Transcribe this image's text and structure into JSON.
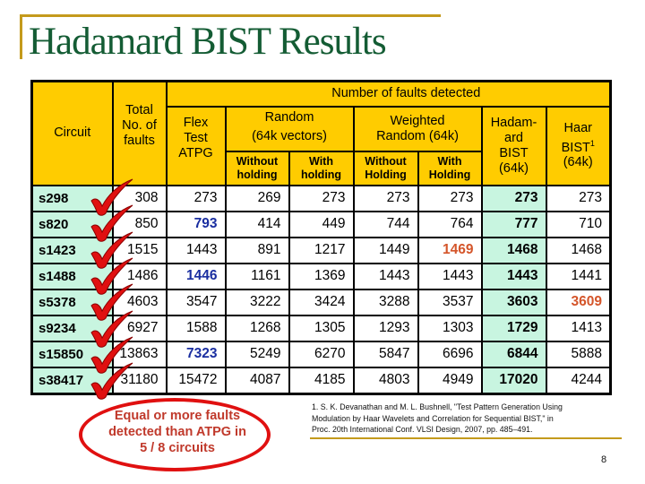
{
  "slide": {
    "title": "Hadamard BIST Results",
    "page_number": "8",
    "accent_color": "#c49a1c",
    "title_color": "#145c34"
  },
  "table": {
    "headers": {
      "circuit": "Circuit",
      "total": [
        "Total",
        "No. of",
        "faults"
      ],
      "group": "Number of faults detected",
      "flex": [
        "Flex",
        "Test",
        "ATPG"
      ],
      "random": [
        "Random",
        "(64k vectors)"
      ],
      "weighted": [
        "Weighted",
        "Random (64k)"
      ],
      "random_without": [
        "Without",
        "holding"
      ],
      "random_with": [
        "With",
        "holding"
      ],
      "weighted_without": [
        "Without",
        "Holding"
      ],
      "weighted_with": [
        "With",
        "Holding"
      ],
      "hadamard": [
        "Hadam-",
        "ard",
        "BIST",
        "(64k)"
      ],
      "haar": [
        "Haar",
        "BIST",
        "1",
        "(64k)"
      ]
    },
    "rows": [
      {
        "circuit": "s298",
        "total": "308",
        "flex": "273",
        "rand_wo": "269",
        "rand_w": "273",
        "wr_wo": "273",
        "wr_w": "273",
        "hadamard": "273",
        "haar": "273",
        "checked": true
      },
      {
        "circuit": "s820",
        "total": "850",
        "flex": "793",
        "rand_wo": "414",
        "rand_w": "449",
        "wr_wo": "744",
        "wr_w": "764",
        "hadamard": "777",
        "haar": "710",
        "checked": true
      },
      {
        "circuit": "s1423",
        "total": "1515",
        "flex": "1443",
        "rand_wo": "891",
        "rand_w": "1217",
        "wr_wo": "1449",
        "wr_w": "1469",
        "hadamard": "1468",
        "haar": "1468",
        "checked": true
      },
      {
        "circuit": "s1488",
        "total": "1486",
        "flex": "1446",
        "rand_wo": "1161",
        "rand_w": "1369",
        "wr_wo": "1443",
        "wr_w": "1443",
        "hadamard": "1443",
        "haar": "1441",
        "checked": true
      },
      {
        "circuit": "s5378",
        "total": "4603",
        "flex": "3547",
        "rand_wo": "3222",
        "rand_w": "3424",
        "wr_wo": "3288",
        "wr_w": "3537",
        "hadamard": "3603",
        "haar": "3609",
        "checked": true
      },
      {
        "circuit": "s9234",
        "total": "6927",
        "flex": "1588",
        "rand_wo": "1268",
        "rand_w": "1305",
        "wr_wo": "1293",
        "wr_w": "1303",
        "hadamard": "1729",
        "haar": "1413",
        "checked": true
      },
      {
        "circuit": "s15850",
        "total": "13863",
        "flex": "7323",
        "rand_wo": "5249",
        "rand_w": "6270",
        "wr_wo": "5847",
        "wr_w": "6696",
        "hadamard": "6844",
        "haar": "5888",
        "checked": true
      },
      {
        "circuit": "s38417",
        "total": "31180",
        "flex": "15472",
        "rand_wo": "4087",
        "rand_w": "4185",
        "wr_wo": "4803",
        "wr_w": "4949",
        "hadamard": "17020",
        "haar": "4244",
        "checked": true
      }
    ],
    "highlights": {
      "blue": [
        "1.flex",
        "3.flex",
        "6.flex"
      ],
      "orange": [
        "2.wr_w",
        "4.haar"
      ]
    },
    "colors": {
      "header_bg": "#ffcc00",
      "circuit_bg": "#c8f5e0",
      "hadamard_bg": "#c8f5e0",
      "blue_text": "#1a2ea0",
      "orange_text": "#d4552a",
      "check": "#e01010"
    }
  },
  "callout": {
    "lines": [
      "Equal or more faults",
      "detected than ATPG in",
      "5 / 8 circuits"
    ],
    "color": "#c0392b"
  },
  "reference": {
    "lines": [
      "1. S. K. Devanathan and M. L. Bushnell, \"Test Pattern Generation Using",
      "Modulation by Haar Wavelets and Correlation for Sequential BIST,\" in",
      "Proc. 20th International Conf. VLSI Design, 2007, pp. 485–491."
    ]
  }
}
